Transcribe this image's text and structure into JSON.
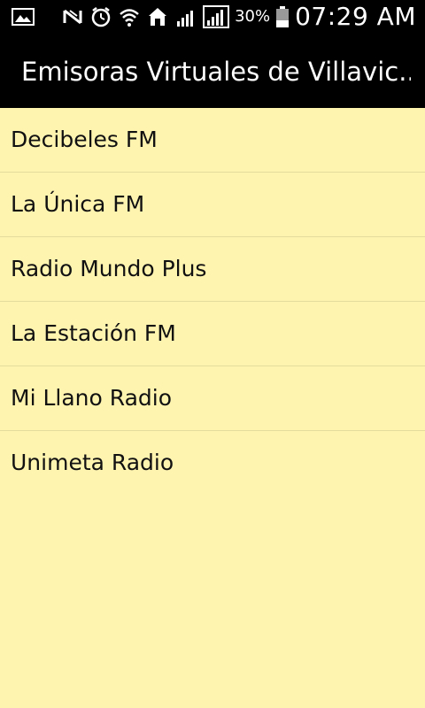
{
  "status_bar": {
    "battery_percent": "30%",
    "time": "07:29 AM",
    "icons": [
      "image-notification-icon",
      "no-signal-icon",
      "alarm-icon",
      "wifi-icon",
      "home-icon",
      "signal-icon",
      "signal-strong-icon",
      "battery-icon"
    ]
  },
  "app": {
    "title": "Emisoras Virtuales de Villavic..."
  },
  "stations": [
    {
      "label": "Decibeles FM"
    },
    {
      "label": "La Única FM"
    },
    {
      "label": "Radio Mundo Plus"
    },
    {
      "label": "La Estación FM"
    },
    {
      "label": "Mi Llano Radio"
    },
    {
      "label": "Unimeta Radio"
    }
  ],
  "colors": {
    "background": "#fff3b0",
    "bar": "#000000",
    "divider": "#e4dc9c"
  }
}
